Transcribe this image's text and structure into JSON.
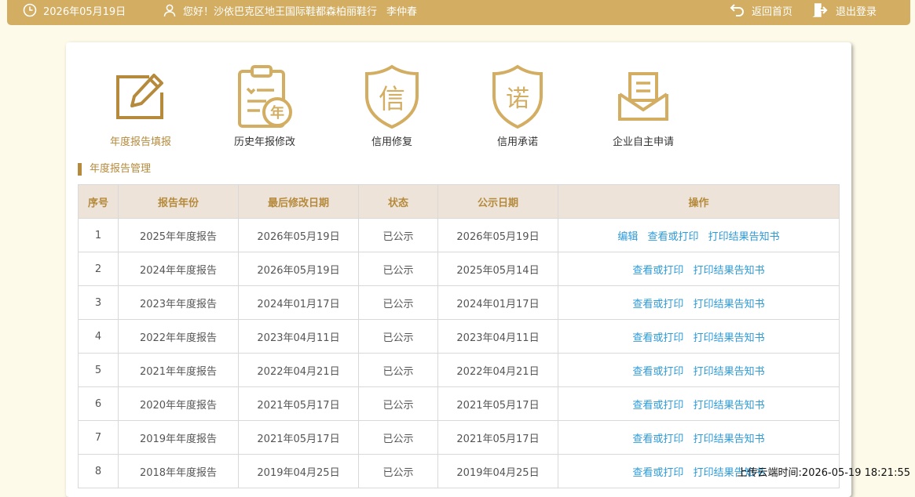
{
  "header": {
    "date": "2026年05月19日",
    "greeting": "您好！沙依巴克区地王国际鞋都森柏丽鞋行",
    "user": "李仲春",
    "home_label": "返回首页",
    "logout_label": "退出登录"
  },
  "menu": [
    {
      "label": "年度报告填报",
      "icon": "edit-report-icon"
    },
    {
      "label": "历史年报修改",
      "icon": "clipboard-year-icon"
    },
    {
      "label": "信用修复",
      "icon": "credit-shield-icon"
    },
    {
      "label": "信用承诺",
      "icon": "promise-shield-icon"
    },
    {
      "label": "企业自主申请",
      "icon": "envelope-icon"
    }
  ],
  "section_title": "年度报告管理",
  "table": {
    "headers": [
      "序号",
      "报告年份",
      "最后修改日期",
      "状态",
      "公示日期",
      "操作"
    ],
    "rows": [
      {
        "no": "1",
        "year": "2025年年度报告",
        "modified": "2026年05月19日",
        "status": "已公示",
        "published": "2026年05月19日",
        "actions": [
          "编辑",
          "查看或打印",
          "打印结果告知书"
        ]
      },
      {
        "no": "2",
        "year": "2024年年度报告",
        "modified": "2026年05月19日",
        "status": "已公示",
        "published": "2025年05月14日",
        "actions": [
          "查看或打印",
          "打印结果告知书"
        ]
      },
      {
        "no": "3",
        "year": "2023年年度报告",
        "modified": "2024年01月17日",
        "status": "已公示",
        "published": "2024年01月17日",
        "actions": [
          "查看或打印",
          "打印结果告知书"
        ]
      },
      {
        "no": "4",
        "year": "2022年年度报告",
        "modified": "2023年04月11日",
        "status": "已公示",
        "published": "2023年04月11日",
        "actions": [
          "查看或打印",
          "打印结果告知书"
        ]
      },
      {
        "no": "5",
        "year": "2021年年度报告",
        "modified": "2022年04月21日",
        "status": "已公示",
        "published": "2022年04月21日",
        "actions": [
          "查看或打印",
          "打印结果告知书"
        ]
      },
      {
        "no": "6",
        "year": "2020年年度报告",
        "modified": "2021年05月17日",
        "status": "已公示",
        "published": "2021年05月17日",
        "actions": [
          "查看或打印",
          "打印结果告知书"
        ]
      },
      {
        "no": "7",
        "year": "2019年年度报告",
        "modified": "2021年05月17日",
        "status": "已公示",
        "published": "2021年05月17日",
        "actions": [
          "查看或打印",
          "打印结果告知书"
        ]
      },
      {
        "no": "8",
        "year": "2018年年度报告",
        "modified": "2019年04月25日",
        "status": "已公示",
        "published": "2019年04月25日",
        "actions": [
          "查看或打印",
          "打印结果告知书"
        ]
      }
    ]
  },
  "upload_stamp": "上传云端时间:2026-05-19 18:21:55",
  "colors": {
    "header_bg": "#d2ad62",
    "accent": "#b58a3c",
    "link": "#2d9bd8",
    "page_bg": "#fefaea",
    "table_head_bg": "#ede3d8"
  }
}
